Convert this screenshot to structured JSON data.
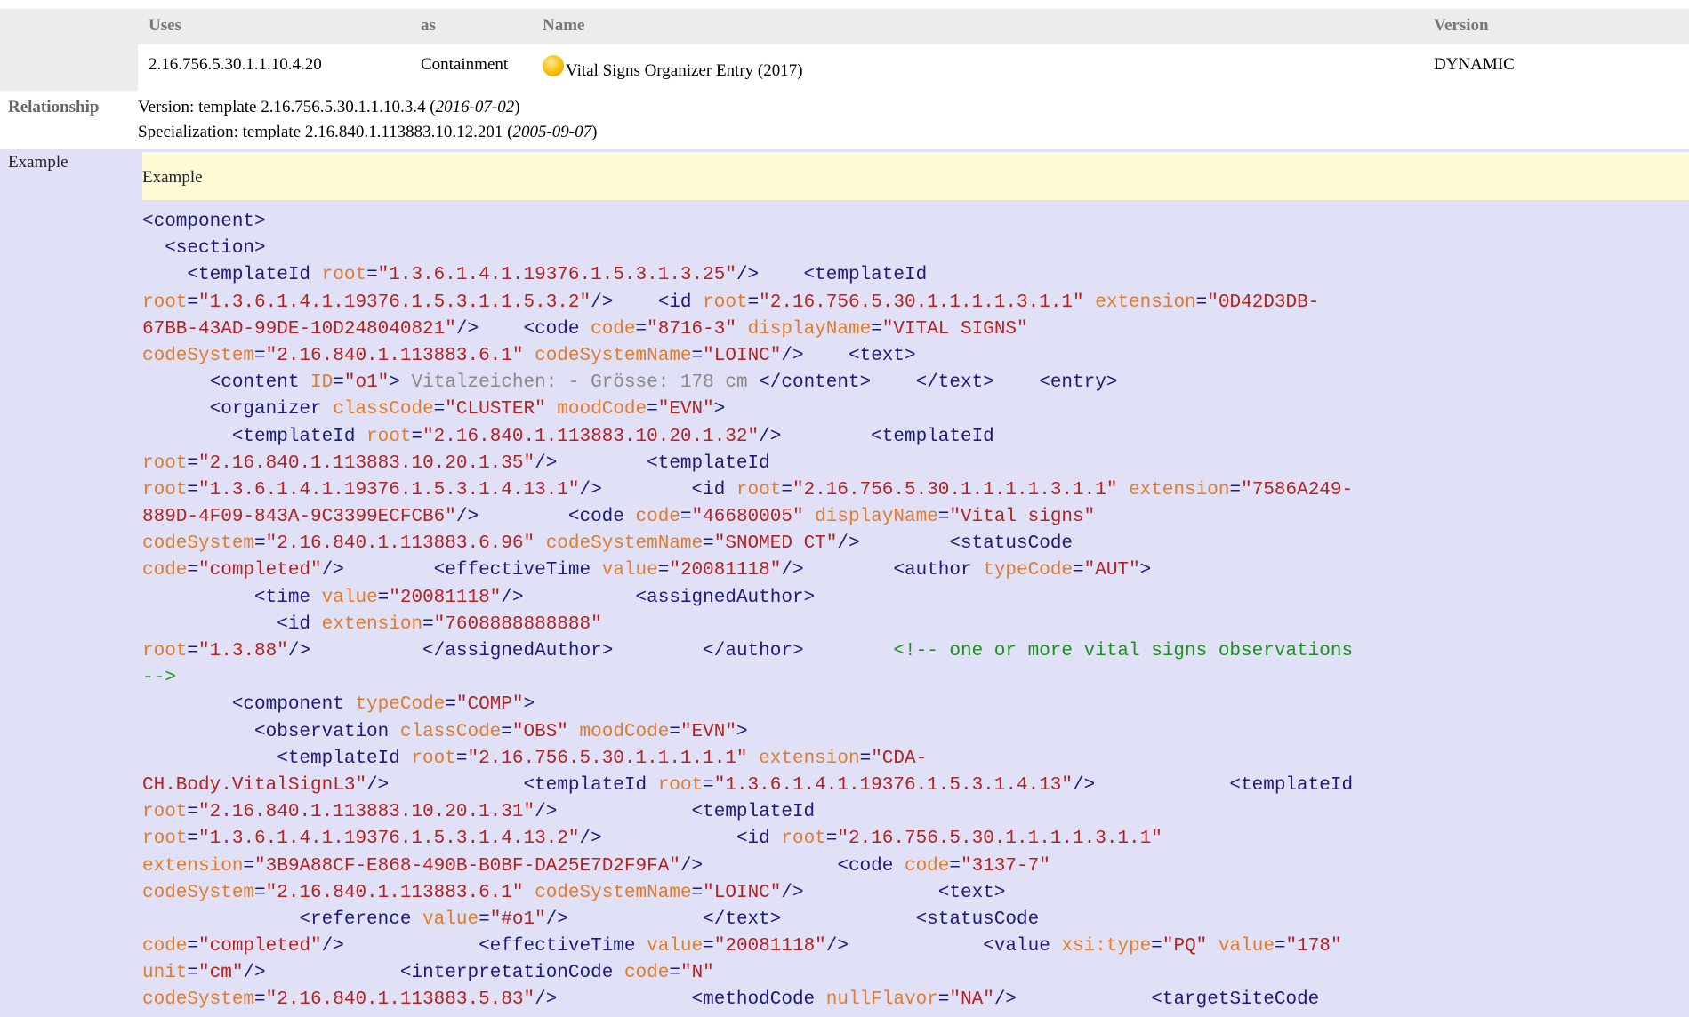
{
  "uses_table": {
    "headers": [
      "Uses",
      "as",
      "Name",
      "Version"
    ],
    "row": {
      "uses": "2.16.756.5.30.1.1.10.4.20",
      "as": "Containment",
      "name": "Vital Signs Organizer Entry (2017)",
      "name_icon": "yellow-circle-icon",
      "version": "DYNAMIC"
    }
  },
  "relationship": {
    "label": "Relationship",
    "version_prefix": "Version: template 2.16.756.5.30.1.1.10.3.4 (",
    "version_date": "2016-07-02",
    "specialization_prefix": "Specialization: template 2.16.840.1.113883.10.12.201 (",
    "specialization_date": "2005-09-07",
    "close": ")"
  },
  "example": {
    "label": "Example",
    "title": "Example",
    "code_lines": [
      [
        [
          "t",
          "<component>"
        ]
      ],
      [
        [
          "t",
          "  <section>"
        ]
      ],
      [
        [
          "t",
          "    <templateId "
        ],
        [
          "a",
          "root"
        ],
        [
          "t",
          "="
        ],
        [
          "v",
          "\"1.3.6.1.4.1.19376.1.5.3.1.3.25\""
        ],
        [
          "t",
          "/>    <templateId"
        ]
      ],
      [
        [
          "a",
          "root"
        ],
        [
          "t",
          "="
        ],
        [
          "v",
          "\"1.3.6.1.4.1.19376.1.5.3.1.1.5.3.2\""
        ],
        [
          "t",
          "/>    <id "
        ],
        [
          "a",
          "root"
        ],
        [
          "t",
          "="
        ],
        [
          "v",
          "\"2.16.756.5.30.1.1.1.1.3.1.1\""
        ],
        [
          "t",
          " "
        ],
        [
          "a",
          "extension"
        ],
        [
          "t",
          "="
        ],
        [
          "v",
          "\"0D42D3DB-"
        ]
      ],
      [
        [
          "v",
          "67BB-43AD-99DE-10D248040821\""
        ],
        [
          "t",
          "/>    <code "
        ],
        [
          "a",
          "code"
        ],
        [
          "t",
          "="
        ],
        [
          "v",
          "\"8716-3\""
        ],
        [
          "t",
          " "
        ],
        [
          "a",
          "displayName"
        ],
        [
          "t",
          "="
        ],
        [
          "v",
          "\"VITAL SIGNS\""
        ]
      ],
      [
        [
          "a",
          "codeSystem"
        ],
        [
          "t",
          "="
        ],
        [
          "v",
          "\"2.16.840.1.113883.6.1\""
        ],
        [
          "t",
          " "
        ],
        [
          "a",
          "codeSystemName"
        ],
        [
          "t",
          "="
        ],
        [
          "v",
          "\"LOINC\""
        ],
        [
          "t",
          "/>    <text>"
        ]
      ],
      [
        [
          "t",
          "      <content "
        ],
        [
          "a",
          "ID"
        ],
        [
          "t",
          "="
        ],
        [
          "v",
          "\"o1\""
        ],
        [
          "t",
          "> "
        ],
        [
          "x",
          "Vitalzeichen: - Grösse: 178 cm"
        ],
        [
          "t",
          " </content>    </text>    <entry>"
        ]
      ],
      [
        [
          "t",
          "      <organizer "
        ],
        [
          "a",
          "classCode"
        ],
        [
          "t",
          "="
        ],
        [
          "v",
          "\"CLUSTER\""
        ],
        [
          "t",
          " "
        ],
        [
          "a",
          "moodCode"
        ],
        [
          "t",
          "="
        ],
        [
          "v",
          "\"EVN\""
        ],
        [
          "t",
          ">"
        ]
      ],
      [
        [
          "t",
          "        <templateId "
        ],
        [
          "a",
          "root"
        ],
        [
          "t",
          "="
        ],
        [
          "v",
          "\"2.16.840.1.113883.10.20.1.32\""
        ],
        [
          "t",
          "/>        <templateId"
        ]
      ],
      [
        [
          "a",
          "root"
        ],
        [
          "t",
          "="
        ],
        [
          "v",
          "\"2.16.840.1.113883.10.20.1.35\""
        ],
        [
          "t",
          "/>        <templateId"
        ]
      ],
      [
        [
          "a",
          "root"
        ],
        [
          "t",
          "="
        ],
        [
          "v",
          "\"1.3.6.1.4.1.19376.1.5.3.1.4.13.1\""
        ],
        [
          "t",
          "/>        <id "
        ],
        [
          "a",
          "root"
        ],
        [
          "t",
          "="
        ],
        [
          "v",
          "\"2.16.756.5.30.1.1.1.1.3.1.1\""
        ],
        [
          "t",
          " "
        ],
        [
          "a",
          "extension"
        ],
        [
          "t",
          "="
        ],
        [
          "v",
          "\"7586A249-"
        ]
      ],
      [
        [
          "v",
          "889D-4F09-843A-9C3399ECFCB6\""
        ],
        [
          "t",
          "/>        <code "
        ],
        [
          "a",
          "code"
        ],
        [
          "t",
          "="
        ],
        [
          "v",
          "\"46680005\""
        ],
        [
          "t",
          " "
        ],
        [
          "a",
          "displayName"
        ],
        [
          "t",
          "="
        ],
        [
          "v",
          "\"Vital signs\""
        ]
      ],
      [
        [
          "a",
          "codeSystem"
        ],
        [
          "t",
          "="
        ],
        [
          "v",
          "\"2.16.840.1.113883.6.96\""
        ],
        [
          "t",
          " "
        ],
        [
          "a",
          "codeSystemName"
        ],
        [
          "t",
          "="
        ],
        [
          "v",
          "\"SNOMED CT\""
        ],
        [
          "t",
          "/>        <statusCode"
        ]
      ],
      [
        [
          "a",
          "code"
        ],
        [
          "t",
          "="
        ],
        [
          "v",
          "\"completed\""
        ],
        [
          "t",
          "/>        <effectiveTime "
        ],
        [
          "a",
          "value"
        ],
        [
          "t",
          "="
        ],
        [
          "v",
          "\"20081118\""
        ],
        [
          "t",
          "/>        <author "
        ],
        [
          "a",
          "typeCode"
        ],
        [
          "t",
          "="
        ],
        [
          "v",
          "\"AUT\""
        ],
        [
          "t",
          ">"
        ]
      ],
      [
        [
          "t",
          "          <time "
        ],
        [
          "a",
          "value"
        ],
        [
          "t",
          "="
        ],
        [
          "v",
          "\"20081118\""
        ],
        [
          "t",
          "/>          <assignedAuthor>"
        ]
      ],
      [
        [
          "t",
          "            <id "
        ],
        [
          "a",
          "extension"
        ],
        [
          "t",
          "="
        ],
        [
          "v",
          "\"7608888888888\""
        ]
      ],
      [
        [
          "a",
          "root"
        ],
        [
          "t",
          "="
        ],
        [
          "v",
          "\"1.3.88\""
        ],
        [
          "t",
          "/>          </assignedAuthor>        </author>        "
        ],
        [
          "c",
          "<!-- one or more vital signs observations"
        ]
      ],
      [
        [
          "c",
          "-->"
        ]
      ],
      [
        [
          "t",
          "        <component "
        ],
        [
          "a",
          "typeCode"
        ],
        [
          "t",
          "="
        ],
        [
          "v",
          "\"COMP\""
        ],
        [
          "t",
          ">"
        ]
      ],
      [
        [
          "t",
          "          <observation "
        ],
        [
          "a",
          "classCode"
        ],
        [
          "t",
          "="
        ],
        [
          "v",
          "\"OBS\""
        ],
        [
          "t",
          " "
        ],
        [
          "a",
          "moodCode"
        ],
        [
          "t",
          "="
        ],
        [
          "v",
          "\"EVN\""
        ],
        [
          "t",
          ">"
        ]
      ],
      [
        [
          "t",
          "            <templateId "
        ],
        [
          "a",
          "root"
        ],
        [
          "t",
          "="
        ],
        [
          "v",
          "\"2.16.756.5.30.1.1.1.1.1\""
        ],
        [
          "t",
          " "
        ],
        [
          "a",
          "extension"
        ],
        [
          "t",
          "="
        ],
        [
          "v",
          "\"CDA-"
        ]
      ],
      [
        [
          "v",
          "CH.Body.VitalSignL3\""
        ],
        [
          "t",
          "/>            <templateId "
        ],
        [
          "a",
          "root"
        ],
        [
          "t",
          "="
        ],
        [
          "v",
          "\"1.3.6.1.4.1.19376.1.5.3.1.4.13\""
        ],
        [
          "t",
          "/>            <templateId"
        ]
      ],
      [
        [
          "a",
          "root"
        ],
        [
          "t",
          "="
        ],
        [
          "v",
          "\"2.16.840.1.113883.10.20.1.31\""
        ],
        [
          "t",
          "/>            <templateId"
        ]
      ],
      [
        [
          "a",
          "root"
        ],
        [
          "t",
          "="
        ],
        [
          "v",
          "\"1.3.6.1.4.1.19376.1.5.3.1.4.13.2\""
        ],
        [
          "t",
          "/>            <id "
        ],
        [
          "a",
          "root"
        ],
        [
          "t",
          "="
        ],
        [
          "v",
          "\"2.16.756.5.30.1.1.1.1.3.1.1\""
        ]
      ],
      [
        [
          "a",
          "extension"
        ],
        [
          "t",
          "="
        ],
        [
          "v",
          "\"3B9A88CF-E868-490B-B0BF-DA25E7D2F9FA\""
        ],
        [
          "t",
          "/>            <code "
        ],
        [
          "a",
          "code"
        ],
        [
          "t",
          "="
        ],
        [
          "v",
          "\"3137-7\""
        ]
      ],
      [
        [
          "a",
          "codeSystem"
        ],
        [
          "t",
          "="
        ],
        [
          "v",
          "\"2.16.840.1.113883.6.1\""
        ],
        [
          "t",
          " "
        ],
        [
          "a",
          "codeSystemName"
        ],
        [
          "t",
          "="
        ],
        [
          "v",
          "\"LOINC\""
        ],
        [
          "t",
          "/>            <text>"
        ]
      ],
      [
        [
          "t",
          "              <reference "
        ],
        [
          "a",
          "value"
        ],
        [
          "t",
          "="
        ],
        [
          "v",
          "\"#o1\""
        ],
        [
          "t",
          "/>            </text>            <statusCode"
        ]
      ],
      [
        [
          "a",
          "code"
        ],
        [
          "t",
          "="
        ],
        [
          "v",
          "\"completed\""
        ],
        [
          "t",
          "/>            <effectiveTime "
        ],
        [
          "a",
          "value"
        ],
        [
          "t",
          "="
        ],
        [
          "v",
          "\"20081118\""
        ],
        [
          "t",
          "/>            <value "
        ],
        [
          "a",
          "xsi:type"
        ],
        [
          "t",
          "="
        ],
        [
          "v",
          "\"PQ\""
        ],
        [
          "t",
          " "
        ],
        [
          "a",
          "value"
        ],
        [
          "t",
          "="
        ],
        [
          "v",
          "\"178\""
        ]
      ],
      [
        [
          "a",
          "unit"
        ],
        [
          "t",
          "="
        ],
        [
          "v",
          "\"cm\""
        ],
        [
          "t",
          "/>            <interpretationCode "
        ],
        [
          "a",
          "code"
        ],
        [
          "t",
          "="
        ],
        [
          "v",
          "\"N\""
        ]
      ],
      [
        [
          "a",
          "codeSystem"
        ],
        [
          "t",
          "="
        ],
        [
          "v",
          "\"2.16.840.1.113883.5.83\""
        ],
        [
          "t",
          "/>            <methodCode "
        ],
        [
          "a",
          "nullFlavor"
        ],
        [
          "t",
          "="
        ],
        [
          "v",
          "\"NA\""
        ],
        [
          "t",
          "/>            <targetSiteCode"
        ]
      ]
    ]
  },
  "colors": {
    "tag": "#1b1b7a",
    "attribute": "#e07b2c",
    "value": "#b22222",
    "text_content": "#888888",
    "comment": "#1e8f1e"
  }
}
